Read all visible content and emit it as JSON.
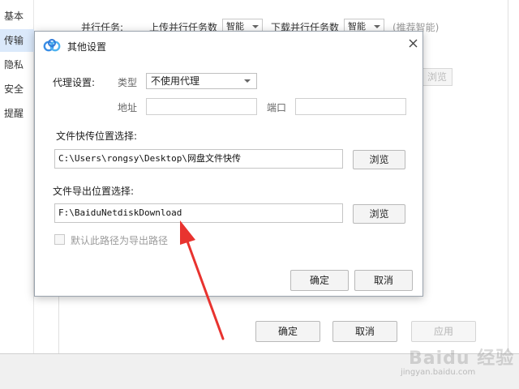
{
  "sidebar": {
    "items": [
      {
        "label": "基本"
      },
      {
        "label": "传输"
      },
      {
        "label": "隐私"
      },
      {
        "label": "安全"
      },
      {
        "label": "提醒"
      }
    ]
  },
  "background": {
    "parallel_label": "并行任务:",
    "upload_label": "上传并行任务数",
    "upload_value": "智能",
    "download_label": "下载并行任务数",
    "download_value": "智能",
    "recommend_hint": "(推荐智能)",
    "partial_button": "浏览",
    "ok_button": "确定",
    "cancel_button": "取消",
    "apply_button": "应用"
  },
  "dialog": {
    "title": "其他设置",
    "proxy": {
      "section_label": "代理设置:",
      "type_label": "类型",
      "type_value": "不使用代理",
      "address_label": "地址",
      "address_value": "",
      "port_label": "端口",
      "port_value": ""
    },
    "shortcut": {
      "section_label": "文件快传位置选择:",
      "path_value": "C:\\Users\\rongsy\\Desktop\\网盘文件快传",
      "browse_button": "浏览"
    },
    "export": {
      "section_label": "文件导出位置选择:",
      "path_value": "F:\\BaiduNetdiskDownload",
      "browse_button": "浏览"
    },
    "default_checkbox": {
      "label": "默认此路径为导出路径",
      "checked": false
    },
    "ok_button": "确定",
    "cancel_button": "取消"
  },
  "watermark": {
    "text": "Baidu 经验",
    "sub": "jingyan.baidu.com"
  },
  "colors": {
    "annotation_arrow": "#e8332f",
    "sidebar_active": "#dbe9fb",
    "logo_blue": "#3a8ee6"
  }
}
